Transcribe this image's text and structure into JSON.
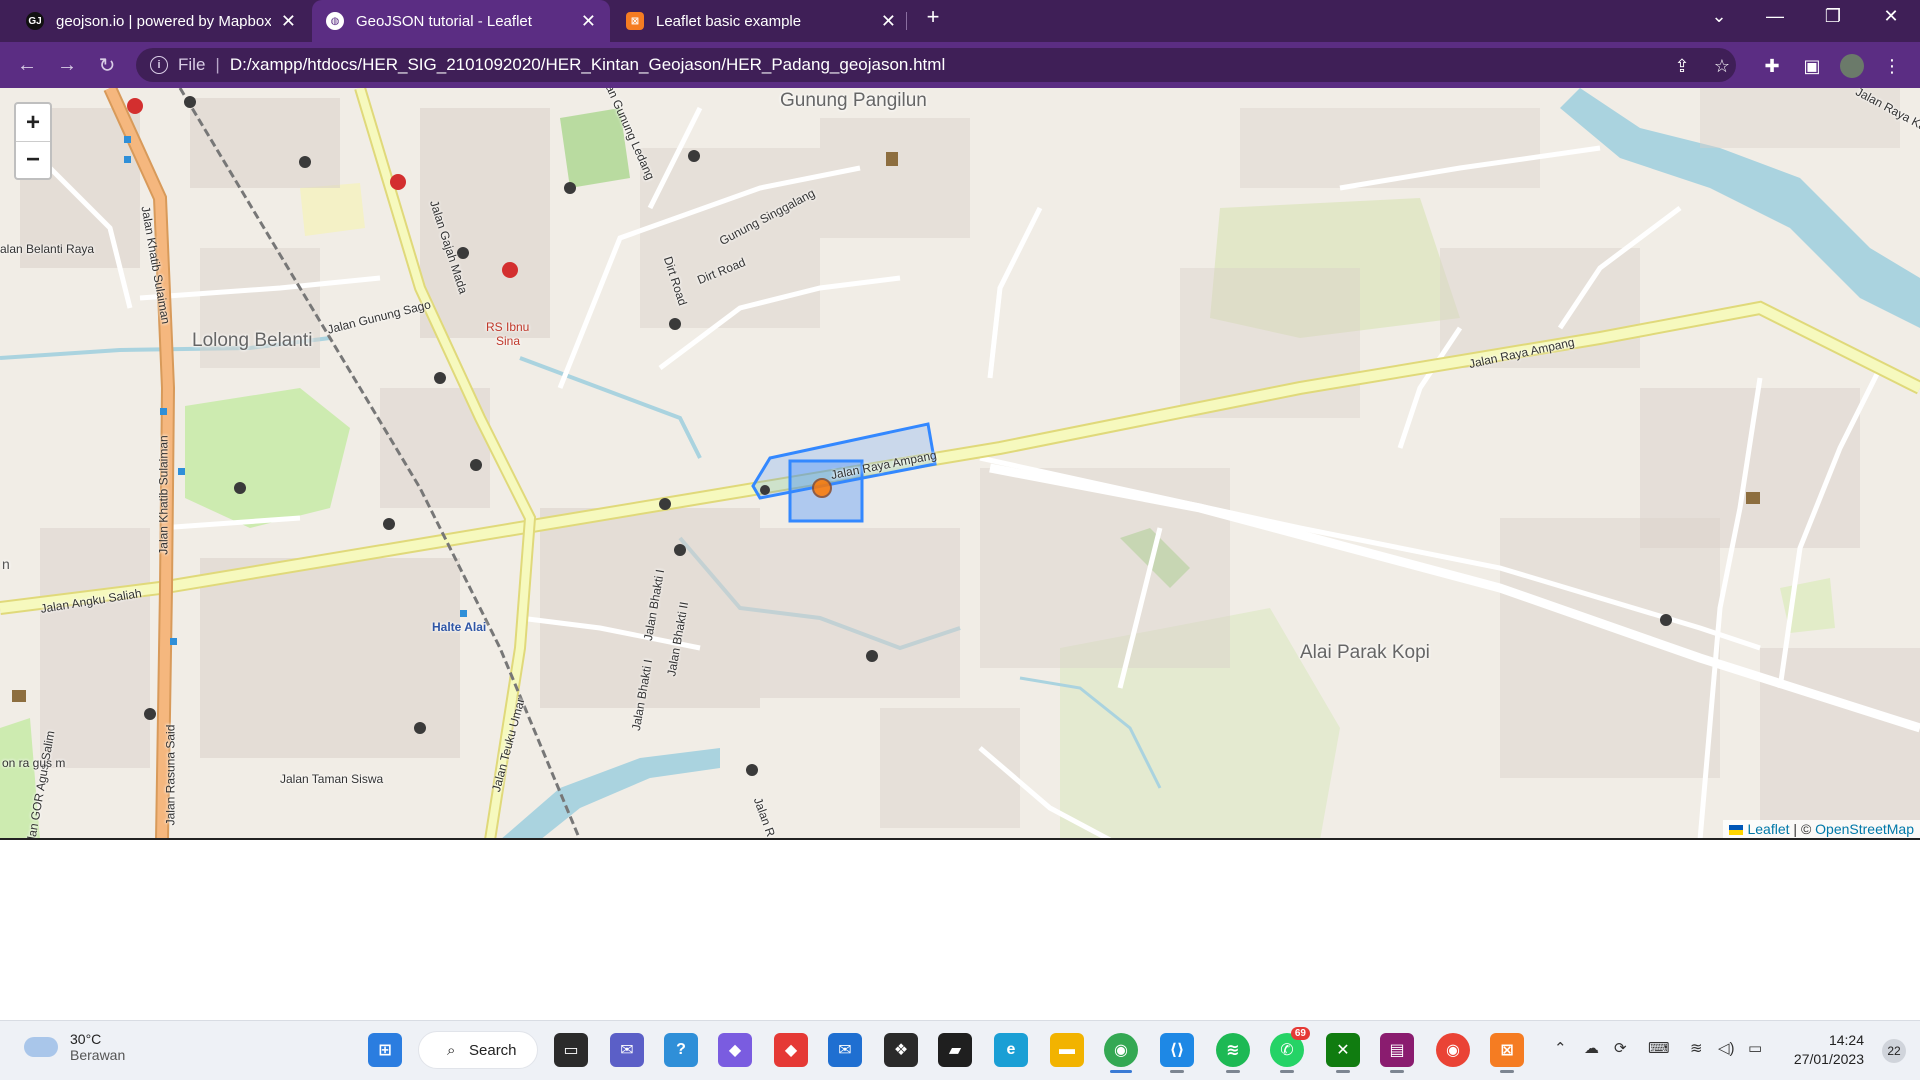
{
  "tabs": [
    {
      "title": "geojson.io | powered by Mapbox",
      "favicon": "GJ",
      "favicon_color": "#111111"
    },
    {
      "title": "GeoJSON tutorial - Leaflet",
      "favicon": "globe",
      "favicon_color": "#ffffff"
    },
    {
      "title": "Leaflet basic example",
      "favicon": "xampp",
      "favicon_color": "#f57c22"
    }
  ],
  "new_tab_label": "+",
  "window": {
    "minimize": "—",
    "maximize": "❐",
    "close": "✕",
    "tab_list": "⌄"
  },
  "addressbar": {
    "scheme": "File",
    "url": "D:/xampp/htdocs/HER_SIG_2101092020/HER_Kintan_Geojason/HER_Padang_geojason.html"
  },
  "map": {
    "zoom_in": "+",
    "zoom_out": "−",
    "attribution_leaflet": "Leaflet",
    "attribution_sep": " | © ",
    "attribution_osm": "OpenStreetMap",
    "labels": {
      "gunung_pangilun": "Gunung Pangilun",
      "lolong_belanti": "Lolong Belanti",
      "alai_parak_kopi": "Alai Parak Kopi",
      "rs_ibnu_sina_1": "RS Ibnu",
      "rs_ibnu_sina_2": "Sina",
      "halte_alai": "Halte Alai",
      "jalan_raya_ampang": "Jalan Raya Ampang",
      "jalan_raya_ampang_2": "Jalan Raya Ampang",
      "jalan_angku_saliah": "Jalan Angku Saliah",
      "jalan_khatib_sulaiman": "Jalan Khatib Sulaiman",
      "jalan_khatib_sulaiman_2": "Jalan Khatib Sulaiman",
      "jalan_gajah_mada": "Jalan Gajah Mada",
      "jalan_gunung_sago": "Jalan Gunung Sago",
      "gunung_singgalang": "Gunung Singgalang",
      "dirt_road": "Dirt Road",
      "dirt_road_2": "Dirt Road",
      "jalan_gunung_ledang": "Jalan Gunung Ledang",
      "jalan_belanti_raya": "alan Belanti Raya",
      "jalan_bhakti_1": "Jalan Bhakti I",
      "jalan_bhakti_2": "Jalan Bhakti II",
      "jalan_bhakti_3": "Jalan Bhakti I",
      "jalan_rasuna_said": "Jalan Rasuna Said",
      "jalan_teuku_umar": "Jalan Teuku Umar",
      "jalan_taman_siswa": "Jalan Taman Siswa",
      "jalan_gor_agus_salim": "lan GOR Agus Salim",
      "jalan_raya_kalumbuk": "Jalan Raya Ka",
      "jalan_r": "Jalan R",
      "park_fragment": "on ra gus m",
      "left_n": "n"
    }
  },
  "taskbar": {
    "weather_temp": "30°C",
    "weather_cond": "Berawan",
    "search_label": "Search",
    "time": "14:24",
    "date": "27/01/2023",
    "notifications": "22",
    "whatsapp_badge": "69"
  }
}
